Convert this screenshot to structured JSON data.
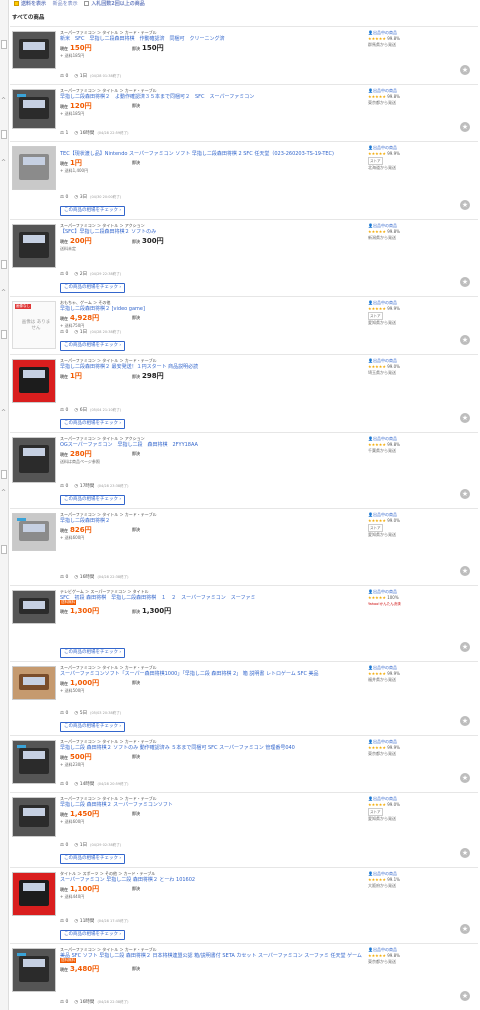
{
  "topbar": {
    "links": [
      "送料を表示",
      "新品を表示",
      "入札回数2回以上の商品"
    ]
  },
  "section_title": "すべての商品",
  "labels": {
    "current": "現在",
    "buynow": "即決",
    "market_btn": "この商品の相場をチェック ›"
  },
  "items": [
    {
      "thumb": "dark",
      "crumbs": "スーパーファミコン ＞ タイトル ＞ カード・テーブル",
      "title": "新米　SFC　早指し二段森田将棋　作動確認済　同梱可　クリーニング済",
      "price": "150円",
      "buynow": "150円",
      "ship": "+ 送料185円",
      "bids": "0",
      "time": "1日",
      "ts": "(04/28 01:38終了)",
      "seller": {
        "name": "出品中の商品",
        "stars": "★★★★★",
        "rate": "99.8%",
        "loc": "群馬県から発送"
      }
    },
    {
      "thumb": "dark",
      "crumbs": "スーパーファミコン ＞ タイトル ＞ カード・テーブル",
      "title": "早指し二段森田将棋２　よ動作確認済３５本まで同梱可２　SFC　スーパーファミコン",
      "price": "120円",
      "buynow": "",
      "ship": "+ 送料185円",
      "bids": "1",
      "time": "16時間",
      "ts": "(04/28 22:59終了)",
      "seller": {
        "name": "出品中の商品",
        "stars": "★★★★★",
        "rate": "99.8%",
        "loc": "東京都から発送"
      }
    },
    {
      "thumb": "gray",
      "crumbs": "",
      "title": "TEC【現状渡し品】Nintendo スーパーファミコン ソフト 早指し二段森田将棋 2 SFC 任天堂（023-260203-TS-19-TEC)",
      "price": "1円",
      "buynow": "",
      "ship": "+ 送料1,400円",
      "bids": "0",
      "time": "3日",
      "ts": "(04/30 20:00終了)",
      "seller": {
        "name": "出品中の商品",
        "stars": "★★★★★",
        "rate": "99.9%",
        "loc": "北海道から発送",
        "tag": "ストア"
      },
      "button": true
    },
    {
      "thumb": "dark",
      "crumbs": "スーパーファミコン ＞ タイトル ＞ アクション",
      "title": "【SFC】早指し二段森田将棋２ ソフトのみ",
      "price": "200円",
      "buynow": "300円",
      "ship": "送料未定",
      "bids": "0",
      "time": "2日",
      "ts": "(04/29 22:38終了)",
      "seller": {
        "name": "出品中の商品",
        "stars": "★★★★★",
        "rate": "99.8%",
        "loc": "新潟県から発送"
      },
      "button": true
    },
    {
      "thumb": "noimg",
      "crumbs": "おもちゃ、ゲーム ＞ その他",
      "title": "早指し二段森田将棋２ [video game]",
      "price": "4,928円",
      "buynow": "",
      "ship": "+ 送料750円",
      "bids": "0",
      "time": "1日",
      "ts": "(04/28 20:38終了)",
      "seller": {
        "name": "出品中の商品",
        "stars": "★★★★★",
        "rate": "99.9%",
        "loc": "愛知県から発送",
        "tag": "ストア"
      },
      "button": true
    },
    {
      "thumb": "red",
      "crumbs": "スーパーファミコン ＞ タイトル ＞ カード・テーブル",
      "title": "早指し二段森田将棋２ 最安発送！１円スタート 商品説明必読",
      "price": "1円",
      "buynow": "298円",
      "ship": "",
      "bids": "0",
      "time": "6日",
      "ts": "(05/04 21:10終了)",
      "seller": {
        "name": "出品中の商品",
        "stars": "★★★★★",
        "rate": "99.0%",
        "loc": "埼玉県から発送"
      },
      "button": true
    },
    {
      "thumb": "dark",
      "crumbs": "スーパーファミコン ＞ タイトル ＞ アクション",
      "title": "OGスーパーファミコン　早指し二段　森田将棋　2FYY18AA",
      "price": "280円",
      "buynow": "",
      "ship": "送料は商品ページ参照",
      "bids": "0",
      "time": "17時間",
      "ts": "(04/28 23:38終了)",
      "seller": {
        "name": "出品中の商品",
        "stars": "★★★★★",
        "rate": "99.8%",
        "loc": "千葉県から発送"
      },
      "button": true
    },
    {
      "thumb": "gray",
      "crumbs": "スーパーファミコン ＞ タイトル ＞ カード・テーブル",
      "title": "早指し二段森田将棋２",
      "price": "826円",
      "buynow": "",
      "ship": "+ 送料600円",
      "bids": "0",
      "time": "16時間",
      "ts": "(04/28 22:38終了)",
      "seller": {
        "name": "出品中の商品",
        "stars": "★★★★★",
        "rate": "99.0%",
        "loc": "愛知県から発送",
        "tag": "ストア"
      }
    },
    {
      "thumb": "dark",
      "crumbs": "テレビゲーム ＞ スーパーファミコン ＞ タイトル",
      "title": "SFC　初段 森田将棋　早指し二段森田将棋　１　２　スーパーファミコン　スーファミ",
      "price": "1,300円",
      "buynow": "1,300円",
      "ship": "",
      "badge": "送料無料",
      "bids": "",
      "time": "",
      "ts": "",
      "seller": {
        "name": "出品中の商品",
        "stars": "★★★★★",
        "rate": "100%",
        "loc": "",
        "pay": "Yahoo!かんたん決済"
      },
      "button": true
    },
    {
      "thumb": "beige",
      "crumbs": "スーパーファミコン ＞ タイトル ＞ カード・テーブル",
      "title": "スーパーファミコンソフト「スーパー森田将棋1000」「早指し二段 森田将棋 2」 箱 説明書 レトロゲーム SFC 美品",
      "price": "1,000円",
      "buynow": "",
      "ship": "+ 送料500円",
      "bids": "0",
      "time": "5日",
      "ts": "(05/03 20:38終了)",
      "seller": {
        "name": "出品中の商品",
        "stars": "★★★★★",
        "rate": "99.9%",
        "loc": "福井県から発送"
      },
      "button": true
    },
    {
      "thumb": "dark",
      "crumbs": "スーパーファミコン ＞ タイトル ＞ カード・テーブル",
      "title": "早指し二段 森田将棋２ ソフトのみ 動作確認済み ５本まで同梱可 SFC スーパーファミコン 管理番号040",
      "price": "500円",
      "buynow": "",
      "ship": "+ 送料230円",
      "bids": "0",
      "time": "14時間",
      "ts": "(04/28 20:59終了)",
      "seller": {
        "name": "出品中の商品",
        "stars": "★★★★★",
        "rate": "99.9%",
        "loc": "東京都から発送"
      }
    },
    {
      "thumb": "dark",
      "crumbs": "スーパーファミコン ＞ タイトル ＞ カード・テーブル",
      "title": "早指し二段 森田将棋２ スーパーファミコンソフト",
      "price": "1,450円",
      "buynow": "",
      "ship": "+ 送料600円",
      "bids": "0",
      "time": "1日",
      "ts": "(04/29 02:38終了)",
      "seller": {
        "name": "出品中の商品",
        "stars": "★★★★★",
        "rate": "99.0%",
        "loc": "愛知県から発送",
        "tag": "ストア"
      },
      "button": true
    },
    {
      "thumb": "red",
      "crumbs": "タイトル ＞ スポーツ ＞ その他 ＞ カード・テーブル",
      "title": "スーパーファミコン 早指し二段 森田将棋２ とーわ 101602",
      "price": "1,100円",
      "buynow": "",
      "ship": "+ 送料440円",
      "bids": "0",
      "time": "11時間",
      "ts": "(04/28 17:45終了)",
      "seller": {
        "name": "出品中の商品",
        "stars": "★★★★★",
        "rate": "99.1%",
        "loc": "大阪府から発送"
      },
      "button": true
    },
    {
      "thumb": "dark",
      "crumbs": "スーパーファミコン ＞ タイトル ＞ カード・テーブル",
      "title": "美品 SFC ソフト 早指し二段 森田将棋２ 日本将棋連盟公認 箱/説明書付 SETA カセット スーパーファミコン スーファミ 任天堂 ゲーム",
      "price": "3,480円",
      "buynow": "",
      "ship": "",
      "badge": "送料無料",
      "bids": "0",
      "time": "16時間",
      "ts": "(04/28 22:38終了)",
      "seller": {
        "name": "出品中の商品",
        "stars": "★★★★★",
        "rate": "99.8%",
        "loc": "東京都から発送"
      }
    }
  ]
}
